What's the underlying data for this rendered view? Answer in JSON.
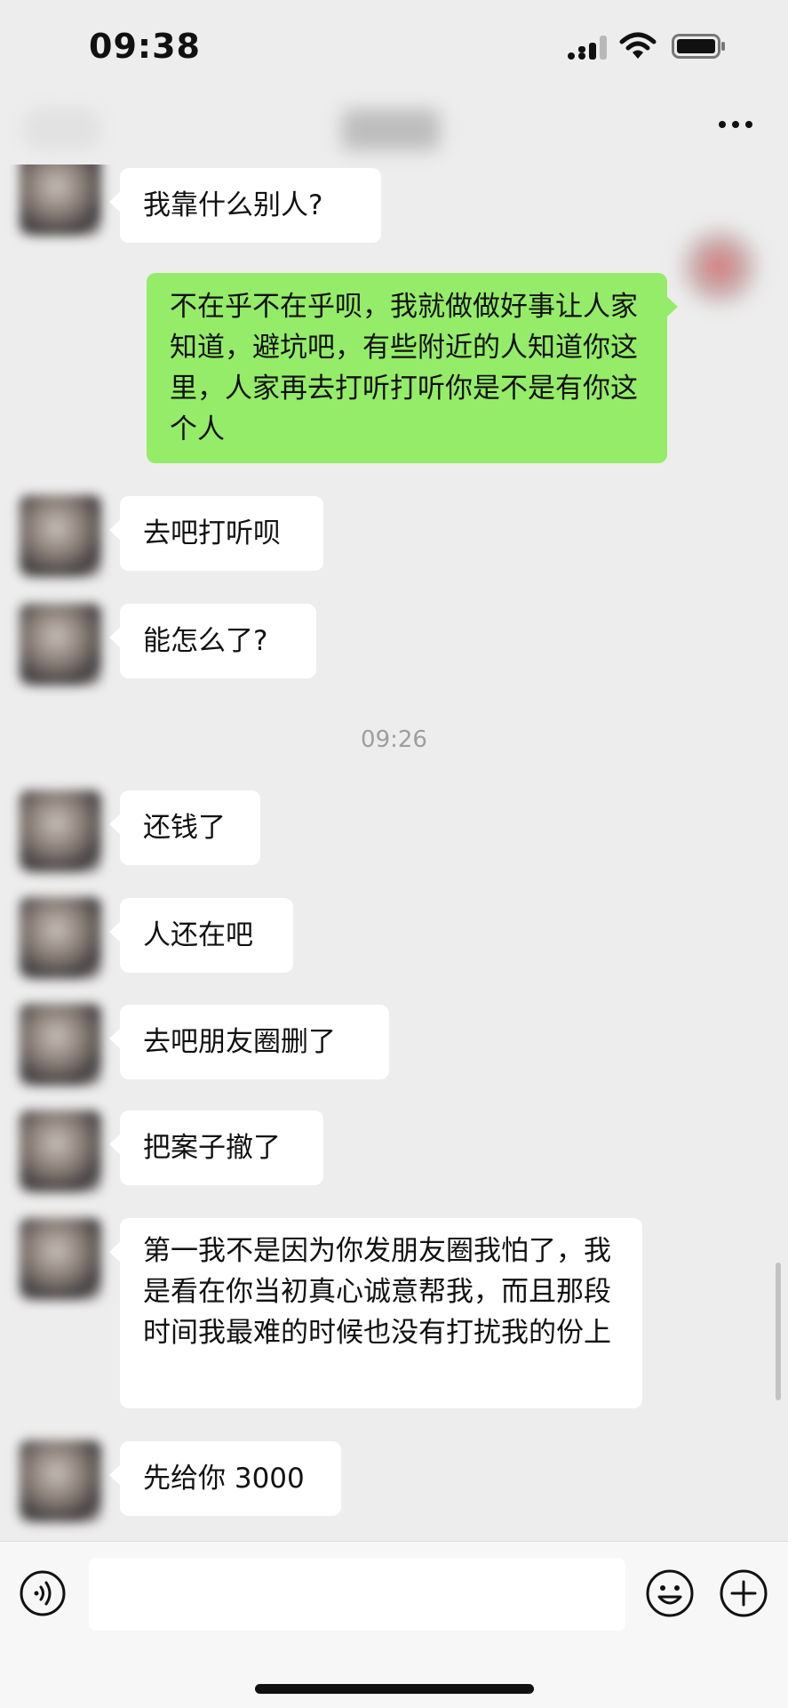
{
  "status_bar": {
    "time": "09:38",
    "icons": [
      "signal-icon",
      "wifi-icon",
      "battery-icon"
    ]
  },
  "nav": {
    "icons": [
      "more-icon"
    ]
  },
  "messages": [
    {
      "side": "left",
      "text": "我靠什么别人?"
    },
    {
      "side": "right",
      "text": "不在乎不在乎呗，我就做做好事让人家知道，避坑吧，有些附近的人知道你这里，人家再去打听打听你是不是有你这个人"
    },
    {
      "side": "left",
      "text": "去吧打听呗"
    },
    {
      "side": "left",
      "text": "能怎么了?"
    },
    {
      "side": "left",
      "text": "还钱了"
    },
    {
      "side": "left",
      "text": "人还在吧"
    },
    {
      "side": "left",
      "text": "去吧朋友圈删了"
    },
    {
      "side": "left",
      "text": "把案子撤了"
    },
    {
      "side": "left",
      "text": "第一我不是因为你发朋友圈我怕了，我是看在你当初真心诚意帮我，而且那段时间我最难的时候也没有打扰我的份上"
    },
    {
      "side": "left",
      "text": "先给你 3000"
    }
  ],
  "timestamp": "09:26",
  "input": {
    "value": "",
    "icons": [
      "voice-icon",
      "emoji-icon",
      "plus-icon"
    ]
  },
  "colors": {
    "background": "#ededed",
    "incoming_bubble": "#ffffff",
    "outgoing_bubble": "#95ec69",
    "timestamp_text": "#9e9e9e"
  }
}
